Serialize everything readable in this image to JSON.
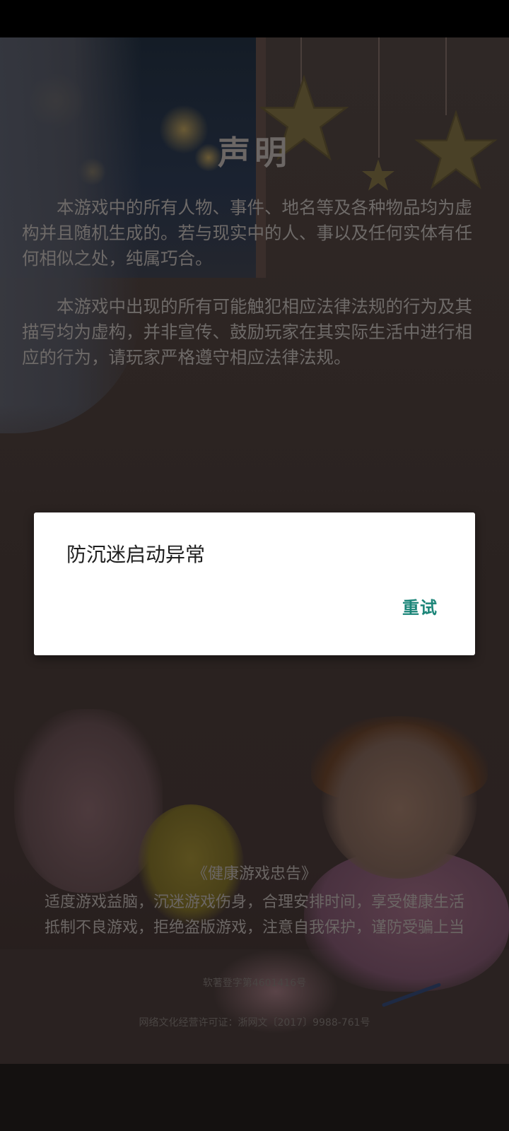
{
  "disclaimer": {
    "title": "声明",
    "paragraphs": [
      "本游戏中的所有人物、事件、地名等及各种物品均为虚构并且随机生成的。若与现实中的人、事以及任何实体有任何相似之处，纯属巧合。",
      "本游戏中出现的所有可能触犯相应法律法规的行为及其描写均为虚构，并非宣传、鼓励玩家在其实际生活中进行相应的行为，请玩家严格遵守相应法律法规。"
    ]
  },
  "health_advice": {
    "title": "《健康游戏忠告》",
    "lines": [
      "适度游戏益脑，沉迷游戏伤身，合理安排时间，享受健康生活",
      "抵制不良游戏，拒绝盗版游戏，注意自我保护，谨防受骗上当"
    ]
  },
  "registration": {
    "software_copyright": "软著登字第4601416号",
    "culture_license": "网络文化经营许可证：浙网文〔2017〕9988-761号"
  },
  "dialog": {
    "message": "防沉迷启动异常",
    "retry_label": "重试",
    "button_color": "#1b8578"
  }
}
